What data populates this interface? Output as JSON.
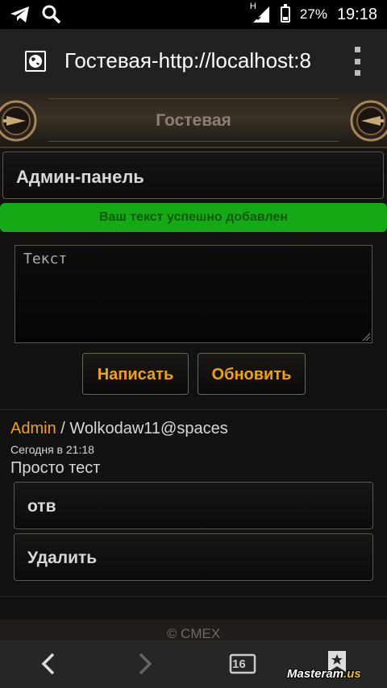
{
  "status_bar": {
    "network": "H",
    "battery": "27%",
    "battery_level": 0.27,
    "time": "19:18",
    "icons": [
      "telegram-icon",
      "search-icon",
      "signal-icon",
      "battery-icon"
    ]
  },
  "browser": {
    "page_title": "Гостевая-http://localhost:8",
    "icons": [
      "globe-icon",
      "overflow-menu-icon"
    ]
  },
  "header": {
    "title": "Гостевая"
  },
  "admin_panel": {
    "label": "Админ-панель"
  },
  "notice": {
    "text": "Ваш текст успешно добавлен",
    "color": "#15aa15"
  },
  "compose": {
    "placeholder": "Текст",
    "value": "",
    "submit_label": "Написать",
    "refresh_label": "Обновить"
  },
  "posts": [
    {
      "author": "Admin",
      "separator": "/",
      "email": "Wolkodaw11@spaces",
      "date": "Сегодня в 21:18",
      "text": "Просто тест",
      "reply_label": "отв",
      "delete_label": "Удалить"
    }
  ],
  "footer": {
    "text": "© CMEX"
  },
  "navigation": {
    "tabs_count": "16",
    "icons": [
      "back-icon",
      "forward-icon",
      "tabs-icon",
      "bookmark-icon"
    ]
  },
  "watermark": {
    "text": "Masteram",
    "suffix": ".us"
  },
  "colors": {
    "accent": "#f0a400",
    "background": "#141210",
    "success": "#15aa15"
  }
}
